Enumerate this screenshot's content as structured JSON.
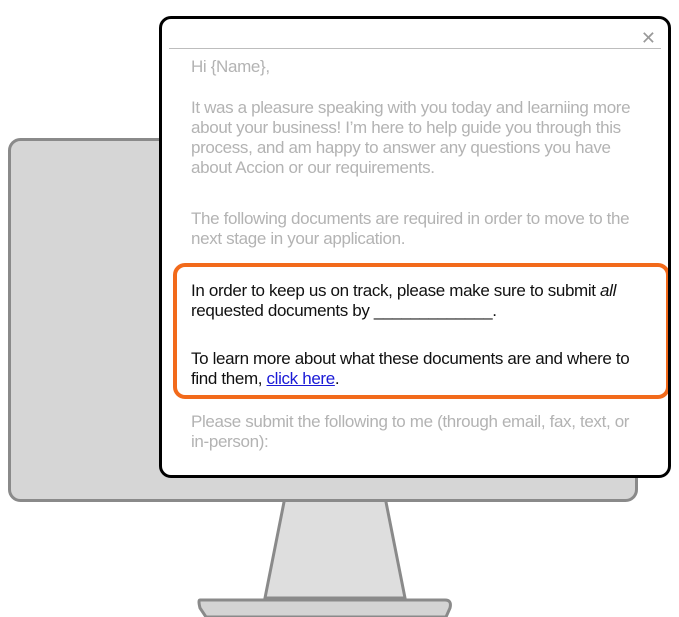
{
  "email": {
    "close_icon": "✕",
    "greeting": "Hi {Name},",
    "para1": "It was a pleasure speaking with you today and learniing more about your business! I’m here to help guide you through this process, and am happy to answer any questions you have about Accion or our requirements.",
    "para2": "The following documents are required in order to move to the next stage in your application.",
    "highlight": {
      "line1_before": "In order to keep us on track, please make sure to submit ",
      "line1_emph": "all",
      "line1_after": " requested documents by _____________.",
      "line2_before": "To learn more about what these documents are and where to find them, ",
      "link": "click here",
      "line2_after": "."
    },
    "para3": "Please submit the following to me (through email, fax, text, or in-person):"
  },
  "colors": {
    "highlight_border": "#f26a1b",
    "monitor_fill": "#d4d4d4",
    "monitor_stroke": "#8a8a8a",
    "link": "#1a1ad6"
  }
}
